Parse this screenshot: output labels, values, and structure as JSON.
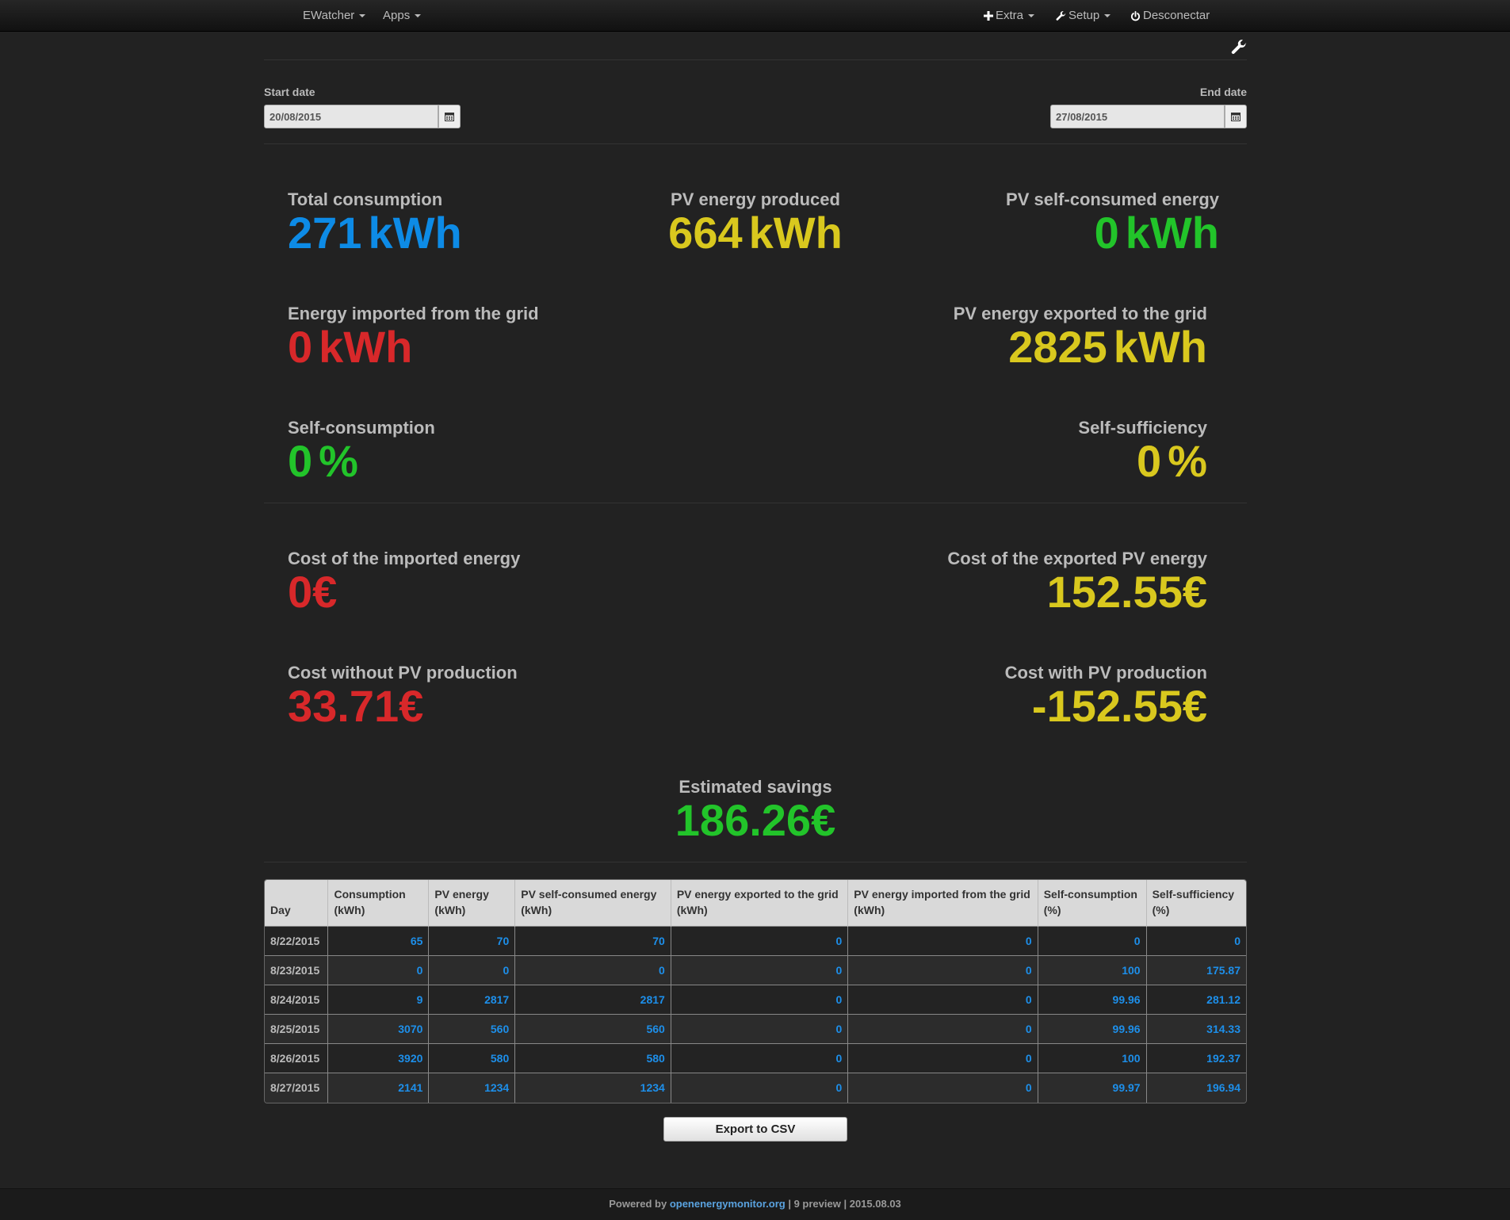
{
  "nav": {
    "ewatcher": "EWatcher",
    "apps": "Apps",
    "extra": "Extra",
    "setup": "Setup",
    "logout": "Desconectar"
  },
  "dates": {
    "start_label": "Start date",
    "start_value": "20/08/2015",
    "end_label": "End date",
    "end_value": "27/08/2015"
  },
  "stats": {
    "total_consumption": {
      "label": "Total consumption",
      "value": "271",
      "unit": "kWh"
    },
    "pv_produced": {
      "label": "PV energy produced",
      "value": "664",
      "unit": "kWh"
    },
    "pv_self_consumed": {
      "label": "PV self-consumed energy",
      "value": "0",
      "unit": "kWh"
    },
    "grid_imported": {
      "label": "Energy imported from the grid",
      "value": "0",
      "unit": "kWh"
    },
    "pv_exported": {
      "label": "PV energy exported to the grid",
      "value": "2825",
      "unit": "kWh"
    },
    "self_consumption": {
      "label": "Self-consumption",
      "value": "0",
      "unit": "%"
    },
    "self_sufficiency": {
      "label": "Self-sufficiency",
      "value": "0",
      "unit": "%"
    },
    "cost_imported": {
      "label": "Cost of the imported energy",
      "value": "0€"
    },
    "cost_exported": {
      "label": "Cost of the exported PV energy",
      "value": "152.55€"
    },
    "cost_without_pv": {
      "label": "Cost without PV production",
      "value": "33.71€"
    },
    "cost_with_pv": {
      "label": "Cost with PV production",
      "value": "-152.55€"
    },
    "savings": {
      "label": "Estimated savings",
      "value": "186.26€"
    }
  },
  "colors": {
    "blue": "#0d8be6",
    "yellow": "#d9c81e",
    "green": "#22c42a",
    "red": "#d8282a"
  },
  "table": {
    "headers": [
      {
        "line1": "Day",
        "line2": ""
      },
      {
        "line1": "Consumption",
        "line2": "(kWh)"
      },
      {
        "line1": "PV energy",
        "line2": "(kWh)"
      },
      {
        "line1": "PV self-consumed energy",
        "line2": "(kWh)"
      },
      {
        "line1": "PV energy exported to the grid",
        "line2": "(kWh)"
      },
      {
        "line1": "PV energy imported from the grid",
        "line2": "(kWh)"
      },
      {
        "line1": "Self-consumption",
        "line2": "(%)"
      },
      {
        "line1": "Self-sufficiency",
        "line2": "(%)"
      }
    ],
    "rows": [
      [
        "8/22/2015",
        "65",
        "70",
        "70",
        "0",
        "0",
        "0",
        "0"
      ],
      [
        "8/23/2015",
        "0",
        "0",
        "0",
        "0",
        "0",
        "100",
        "175.87"
      ],
      [
        "8/24/2015",
        "9",
        "2817",
        "2817",
        "0",
        "0",
        "99.96",
        "281.12"
      ],
      [
        "8/25/2015",
        "3070",
        "560",
        "560",
        "0",
        "0",
        "99.96",
        "314.33"
      ],
      [
        "8/26/2015",
        "3920",
        "580",
        "580",
        "0",
        "0",
        "100",
        "192.37"
      ],
      [
        "8/27/2015",
        "2141",
        "1234",
        "1234",
        "0",
        "0",
        "99.97",
        "196.94"
      ]
    ]
  },
  "export_label": "Export to CSV",
  "footer": {
    "prefix": "Powered by",
    "link": "openenergymonitor.org",
    "suffix": "| 9 preview | 2015.08.03"
  }
}
